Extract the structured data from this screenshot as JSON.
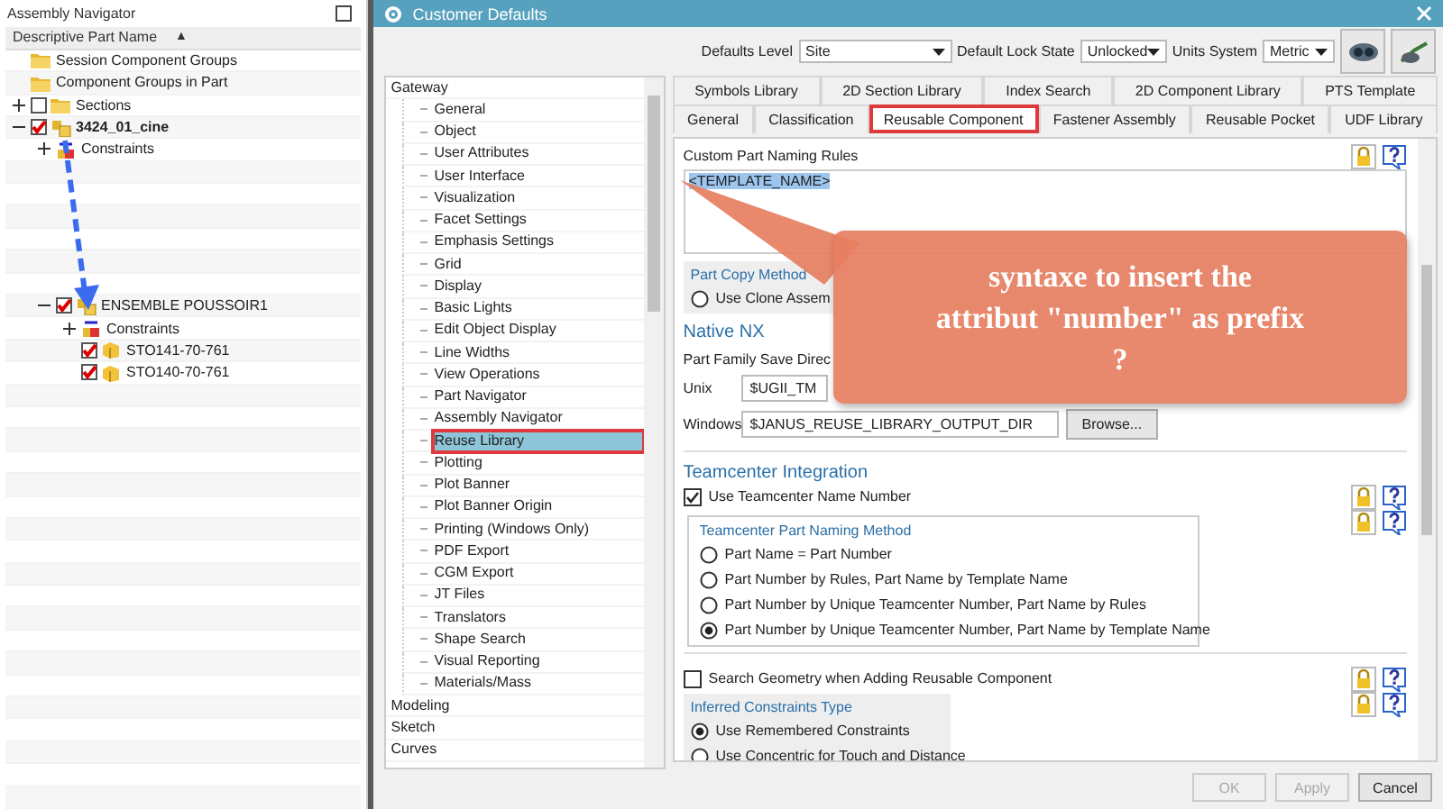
{
  "navigator": {
    "title": "Assembly Navigator",
    "column": "Descriptive Part Name",
    "sort_glyph": "▲",
    "tree": [
      {
        "label": "Session Component Groups",
        "kind": "folder"
      },
      {
        "label": "Component Groups in Part",
        "kind": "folder"
      },
      {
        "label": "Sections",
        "kind": "folder",
        "checked": false,
        "expanded": false
      },
      {
        "label": "3424_01_cine",
        "kind": "displayed_assembly",
        "checked": true,
        "expanded": true,
        "children": [
          {
            "label": "Constraints",
            "kind": "constraints",
            "expanded": false
          },
          {
            "label": "ENSEMBLE POUSSOIR1",
            "kind": "assembly",
            "checked": true,
            "expanded": true,
            "children": [
              {
                "label": "Constraints",
                "kind": "constraints",
                "expanded": false
              },
              {
                "label": "STO141-70-761",
                "kind": "part",
                "checked": true
              },
              {
                "label": "STO140-70-761",
                "kind": "part",
                "checked": true
              }
            ]
          }
        ]
      }
    ]
  },
  "dialog": {
    "title": "Customer Defaults",
    "toolbar": [
      {
        "label": "Defaults Level",
        "value": "Site"
      },
      {
        "label": "Default Lock State",
        "value": "Unlocked"
      },
      {
        "label": "Units System",
        "value": "Metric"
      }
    ],
    "categories": [
      {
        "label": "Gateway",
        "selected": false,
        "children": [
          {
            "label": "General",
            "selected": false
          },
          {
            "label": "Object",
            "selected": false
          },
          {
            "label": "User Attributes",
            "selected": false
          },
          {
            "label": "User Interface",
            "selected": false
          },
          {
            "label": "Visualization",
            "selected": false
          },
          {
            "label": "Facet Settings",
            "selected": false
          },
          {
            "label": "Emphasis Settings",
            "selected": false
          },
          {
            "label": "Grid",
            "selected": false
          },
          {
            "label": "Display",
            "selected": false
          },
          {
            "label": "Basic Lights",
            "selected": false
          },
          {
            "label": "Edit Object Display",
            "selected": false
          },
          {
            "label": "Line Widths",
            "selected": false
          },
          {
            "label": "View Operations",
            "selected": false
          },
          {
            "label": "Part Navigator",
            "selected": false
          },
          {
            "label": "Assembly Navigator",
            "selected": false
          },
          {
            "label": "Reuse Library",
            "selected": true
          },
          {
            "label": "Plotting",
            "selected": false
          },
          {
            "label": "Plot Banner",
            "selected": false
          },
          {
            "label": "Plot Banner Origin",
            "selected": false
          },
          {
            "label": "Printing (Windows Only)",
            "selected": false
          },
          {
            "label": "PDF Export",
            "selected": false
          },
          {
            "label": "CGM Export",
            "selected": false
          },
          {
            "label": "JT Files",
            "selected": false
          },
          {
            "label": "Translators",
            "selected": false
          },
          {
            "label": "Shape Search",
            "selected": false
          },
          {
            "label": "Visual Reporting",
            "selected": false
          },
          {
            "label": "Materials/Mass",
            "selected": false
          }
        ]
      },
      {
        "label": "Modeling",
        "selected": false
      },
      {
        "label": "Sketch",
        "selected": false
      },
      {
        "label": "Curves",
        "selected": false
      }
    ],
    "tab_rows": [
      [
        {
          "label": "Symbols Library",
          "selected": false
        },
        {
          "label": "2D Section Library",
          "selected": false
        },
        {
          "label": "Index Search",
          "selected": false
        },
        {
          "label": "2D Component Library",
          "selected": false
        },
        {
          "label": "PTS Template",
          "selected": false
        }
      ],
      [
        {
          "label": "General",
          "selected": false
        },
        {
          "label": "Classification",
          "selected": false
        },
        {
          "label": "Reusable Component",
          "selected": true
        },
        {
          "label": "Fastener Assembly",
          "selected": false
        },
        {
          "label": "Reusable Pocket",
          "selected": false
        },
        {
          "label": "UDF Library",
          "selected": false
        }
      ]
    ],
    "naming_rules": {
      "label": "Custom Part Naming Rules",
      "value": "<TEMPLATE_NAME>"
    },
    "part_copy": {
      "title": "Part Copy Method",
      "options": [
        {
          "label": "Use Clone Assem",
          "selected": false
        }
      ]
    },
    "native": {
      "title": "Native NX",
      "label": "Part Family Save Direc",
      "fields": [
        {
          "label": "Unix",
          "value": "$UGII_TM"
        },
        {
          "label": "Windows",
          "value": "$JANUS_REUSE_LIBRARY_OUTPUT_DIR",
          "button": "Browse..."
        }
      ]
    },
    "teamcenter": {
      "title": "Teamcenter Integration",
      "checkbox": {
        "label": "Use Teamcenter Name Number",
        "checked": true
      },
      "method_title": "Teamcenter Part Naming Method",
      "options": [
        {
          "label": "Part Name = Part Number",
          "selected": false
        },
        {
          "label": "Part Number by Rules, Part Name by Template Name",
          "selected": false
        },
        {
          "label": "Part Number by Unique Teamcenter Number, Part Name by Rules",
          "selected": false
        },
        {
          "label": "Part Number by Unique Teamcenter Number, Part Name by Template Name",
          "selected": true
        }
      ]
    },
    "search_geometry": {
      "label": "Search Geometry when Adding Reusable Component",
      "checked": false
    },
    "inferred": {
      "title": "Inferred Constraints Type",
      "options": [
        {
          "label": "Use Remembered Constraints",
          "selected": true
        },
        {
          "label": "Use Concentric for Touch and Distance",
          "selected": false
        }
      ]
    },
    "buttons": [
      {
        "label": "OK",
        "disabled": true
      },
      {
        "label": "Apply",
        "disabled": true
      },
      {
        "label": "Cancel",
        "disabled": false
      }
    ]
  },
  "callout": {
    "text": "syntaxe to insert the\nattribut \"number\" as prefix\n?"
  }
}
